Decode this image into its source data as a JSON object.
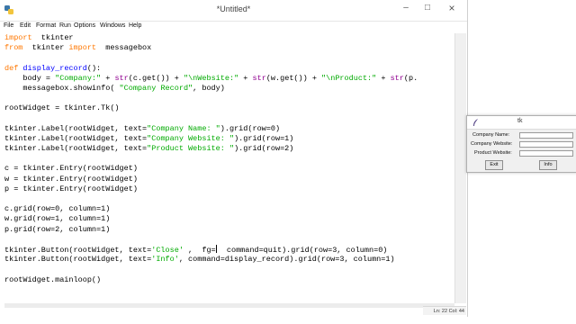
{
  "editor": {
    "title": "*Untitled*",
    "controls": {
      "minimize": "–",
      "maximize": "□",
      "close": "×"
    },
    "menu": [
      "File",
      "Edit",
      "Format",
      "Run",
      "Options",
      "Windows",
      "Help"
    ],
    "status": "Ln: 22 Col: 44",
    "code": [
      [
        [
          "kw",
          "import"
        ],
        [
          "",
          "  tkinter"
        ]
      ],
      [
        [
          "kw",
          "from"
        ],
        [
          "",
          "  tkinter "
        ],
        [
          "kw",
          "import"
        ],
        [
          "",
          "  messagebox"
        ]
      ],
      [],
      [
        [
          "kw",
          "def"
        ],
        [
          "",
          " "
        ],
        [
          "fn",
          "display_record"
        ],
        [
          "",
          "():"
        ]
      ],
      [
        [
          "",
          "    body = "
        ],
        [
          "str",
          "\"Company:\""
        ],
        [
          "",
          " + "
        ],
        [
          "bi",
          "str"
        ],
        [
          "",
          "(c.get()) + "
        ],
        [
          "str",
          "\"\\nWebsite:\""
        ],
        [
          "",
          " + "
        ],
        [
          "bi",
          "str"
        ],
        [
          "",
          "(w.get()) + "
        ],
        [
          "str",
          "\"\\nProduct:\""
        ],
        [
          "",
          " + "
        ],
        [
          "bi",
          "str"
        ],
        [
          "",
          "(p."
        ]
      ],
      [
        [
          "",
          "    messagebox.showinfo( "
        ],
        [
          "str",
          "\"Company Record\""
        ],
        [
          "",
          ", body)"
        ]
      ],
      [],
      [
        [
          "",
          "rootWidget = tkinter.Tk()"
        ]
      ],
      [],
      [
        [
          "",
          "tkinter.Label(rootWidget, text="
        ],
        [
          "str",
          "\"Company Name: \""
        ],
        [
          "",
          ").grid(row=0)"
        ]
      ],
      [
        [
          "",
          "tkinter.Label(rootWidget, text="
        ],
        [
          "str",
          "\"Company Website: \""
        ],
        [
          "",
          ").grid(row=1)"
        ]
      ],
      [
        [
          "",
          "tkinter.Label(rootWidget, text="
        ],
        [
          "str",
          "\"Product Website: \""
        ],
        [
          "",
          ").grid(row=2)"
        ]
      ],
      [],
      [
        [
          "",
          "c = tkinter.Entry(rootWidget)"
        ]
      ],
      [
        [
          "",
          "w = tkinter.Entry(rootWidget)"
        ]
      ],
      [
        [
          "",
          "p = tkinter.Entry(rootWidget)"
        ]
      ],
      [],
      [
        [
          "",
          "c.grid(row=0, column=1)"
        ]
      ],
      [
        [
          "",
          "w.grid(row=1, column=1)"
        ]
      ],
      [
        [
          "",
          "p.grid(row=2, column=1)"
        ]
      ],
      [],
      [
        [
          "",
          "tkinter.Button(rootWidget, text="
        ],
        [
          "str",
          "'Close'"
        ],
        [
          "",
          " ,  fg="
        ],
        [
          "cursor",
          ""
        ],
        [
          "",
          "  command=quit).grid(row=3, column=0)"
        ]
      ],
      [
        [
          "",
          "tkinter.Button(rootWidget, text="
        ],
        [
          "str",
          "'Info'"
        ],
        [
          "",
          ", command=display_record).grid(row=3, column=1)"
        ]
      ],
      [],
      [
        [
          "",
          "rootWidget.mainloop()"
        ]
      ]
    ]
  },
  "tk_window": {
    "title": "tk",
    "labels": [
      "Company Name:",
      "Company Website:",
      "Product Website:"
    ],
    "entries": [
      "",
      "",
      ""
    ],
    "exit_label": "Exit",
    "info_label": "Info"
  }
}
